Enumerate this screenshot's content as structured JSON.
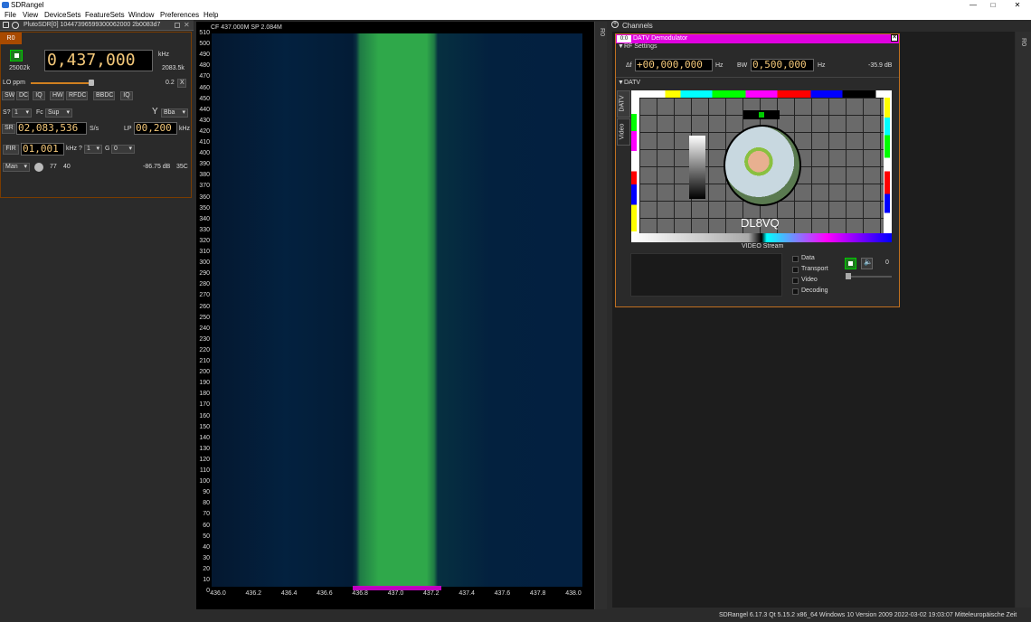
{
  "window": {
    "title": "SDRangel",
    "controls": [
      "—",
      "□",
      "✕"
    ]
  },
  "menu": {
    "items": [
      "File",
      "View",
      "DeviceSets",
      "FeatureSets",
      "Window",
      "Preferences",
      "Help"
    ]
  },
  "device": {
    "name": "PlutoSDR[0] 10447396599300062000 2b0083d7",
    "tab": "R0",
    "sample_rate_short": "25002k",
    "center_freq": "0,437,000",
    "freq_unit": "kHz",
    "freq_right": "2083.5k",
    "lo_ppm_label": "LO ppm",
    "lo_ppm_value": "0.2",
    "lo_ppm_clear": "X",
    "buttons": [
      "SW",
      "DC",
      "IQ",
      "HW",
      "RFDC",
      "BBDC",
      "IQ"
    ],
    "swap_label": "S?",
    "swap_value": "1",
    "fc_label": "Fc",
    "fc_value": "Sup",
    "antenna_value": "Bba",
    "sr_label": "SR",
    "sr_value": "02,083,536",
    "sr_unit": "S/s",
    "lp_label": "LP",
    "lp_value": "00,200",
    "lp_unit": "kHz",
    "fir_label": "FIR",
    "fir_value": "01,001",
    "fir_unit": "kHz ?",
    "fir_sel": "1",
    "g_label": "G",
    "g_sel": "0",
    "gain_mode": "Man",
    "gain_value": "77",
    "gain_value2": "40",
    "power": "-86.75 dB",
    "temp": "35C"
  },
  "spectrum": {
    "header": "CF 437.000M SP 2.084M",
    "y_ticks": [
      "510",
      "500",
      "490",
      "480",
      "470",
      "460",
      "450",
      "440",
      "430",
      "420",
      "410",
      "400",
      "390",
      "380",
      "370",
      "360",
      "350",
      "340",
      "330",
      "320",
      "310",
      "300",
      "290",
      "280",
      "270",
      "260",
      "250",
      "240",
      "230",
      "220",
      "210",
      "200",
      "190",
      "180",
      "170",
      "160",
      "150",
      "140",
      "130",
      "120",
      "110",
      "100",
      "90",
      "80",
      "70",
      "60",
      "50",
      "40",
      "30",
      "20",
      "10",
      "0"
    ],
    "x_ticks": [
      "436.0",
      "436.2",
      "436.4",
      "436.6",
      "436.8",
      "437.0",
      "437.2",
      "437.4",
      "437.6",
      "437.8",
      "438.0"
    ]
  },
  "side_tab": "R0",
  "channels": {
    "title": "Channels",
    "right_tab": "R0",
    "datv": {
      "badge": "0:0",
      "title": "DATV Demodulator",
      "rf_settings": "RF Settings",
      "delta_label": "Δf",
      "delta_value": "+00,000,000",
      "delta_unit": "Hz",
      "bw_label": "BW",
      "bw_value": "0,500,000",
      "bw_unit": "Hz",
      "level": "-35.9 dB",
      "section": "DATV",
      "vtabs": [
        "DATV",
        "Video"
      ],
      "callsign": "DL8VQ",
      "stream_label": "VIDEO Stream",
      "checks": [
        "Data",
        "Transport",
        "Video",
        "Decoding"
      ],
      "count": "0"
    }
  },
  "status": "SDRangel 6.17.3 Qt 5.15.2 x86_64 Windows 10 Version 2009  2022-03-02 19:03:07 Mitteleuropäische Zeit",
  "colors": {
    "accent": "#e000e0",
    "waterfall_band": "#2fa84a",
    "dial_text": "#f5c97a"
  }
}
